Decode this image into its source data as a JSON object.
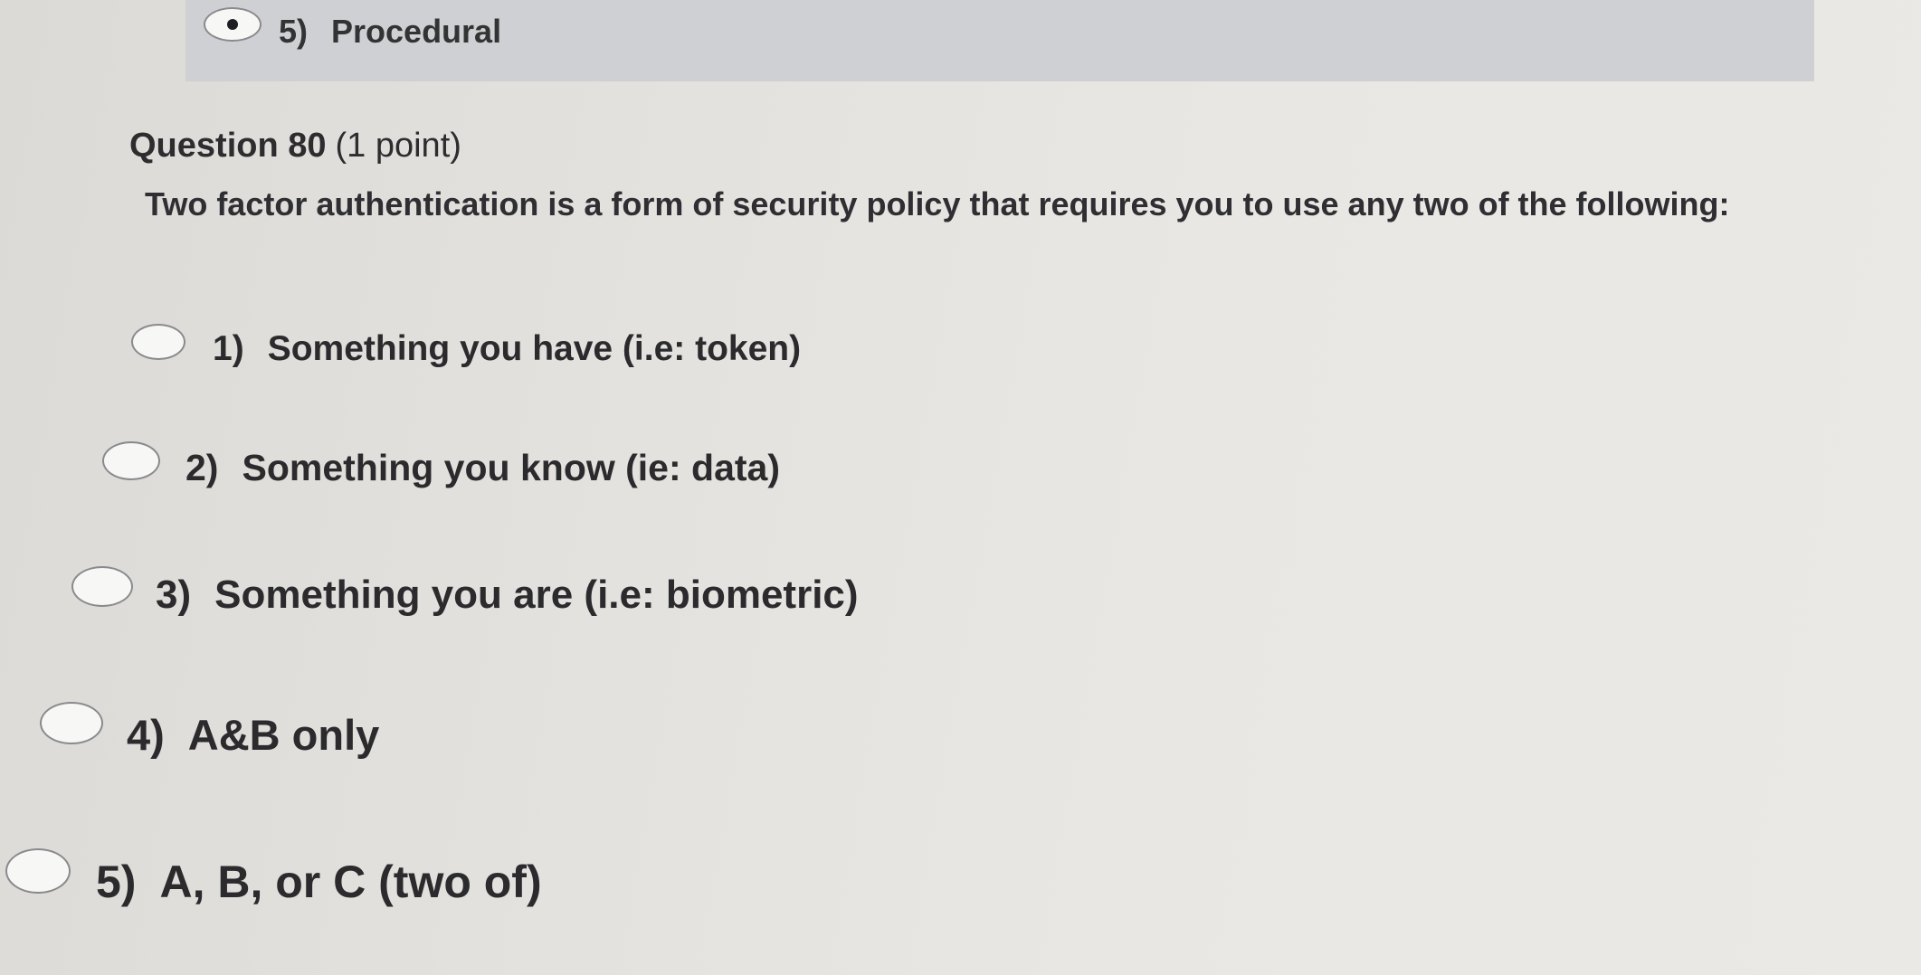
{
  "previous_question": {
    "selected_option": {
      "number": "5)",
      "label": "Procedural"
    }
  },
  "question": {
    "title": "Question 80",
    "points": "(1 point)",
    "text": "Two factor authentication is a form of security policy that requires you to use any two of the following:",
    "options": [
      {
        "number": "1)",
        "label": "Something you have (i.e: token)",
        "selected": false
      },
      {
        "number": "2)",
        "label": "Something you know (ie: data)",
        "selected": false
      },
      {
        "number": "3)",
        "label": "Something you are (i.e: biometric)",
        "selected": false
      },
      {
        "number": "4)",
        "label": "A&B only",
        "selected": false
      },
      {
        "number": "5)",
        "label": "A, B, or C (two of)",
        "selected": false
      }
    ]
  }
}
